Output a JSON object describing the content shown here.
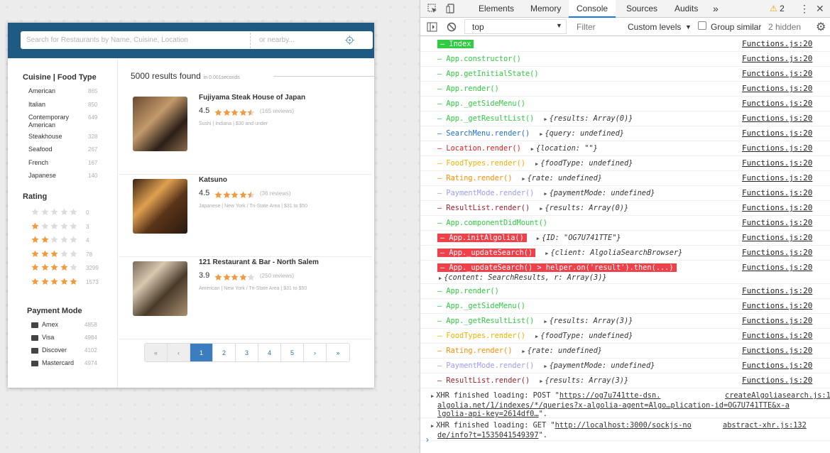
{
  "search": {
    "placeholder": "Search for Restaurants by Name, Cuisine, Location",
    "nearby_placeholder": "or nearby..."
  },
  "sidebar": {
    "cuisine_title": "Cuisine | Food Type",
    "cuisines": [
      {
        "name": "American",
        "count": "865"
      },
      {
        "name": "Italian",
        "count": "850"
      },
      {
        "name": "Contemporary American",
        "count": "649"
      },
      {
        "name": "Steakhouse",
        "count": "328"
      },
      {
        "name": "Seafood",
        "count": "267"
      },
      {
        "name": "French",
        "count": "167"
      },
      {
        "name": "Japanese",
        "count": "140"
      }
    ],
    "rating_title": "Rating",
    "ratings": [
      {
        "stars": 0,
        "count": "0"
      },
      {
        "stars": 1,
        "count": "3"
      },
      {
        "stars": 2,
        "count": "4"
      },
      {
        "stars": 3,
        "count": "78"
      },
      {
        "stars": 4,
        "count": "3299"
      },
      {
        "stars": 5,
        "count": "1573"
      }
    ],
    "payment_title": "Payment Mode",
    "payments": [
      {
        "name": "Amex",
        "count": "4858"
      },
      {
        "name": "Visa",
        "count": "4984"
      },
      {
        "name": "Discover",
        "count": "4102"
      },
      {
        "name": "Mastercard",
        "count": "4974"
      }
    ]
  },
  "results": {
    "count_text": "5000 results found",
    "time_text": "in 0.001seconds",
    "items": [
      {
        "name": "Fujiyama Steak House of Japan",
        "score": "4.5",
        "stars": 4.5,
        "reviews": "(165 reviews)",
        "meta": "Sushi | Indiana | $30 and under"
      },
      {
        "name": "Katsuno",
        "score": "4.5",
        "stars": 4.5,
        "reviews": "(36 reviews)",
        "meta": "Japanese | New York / Tri-State Area | $31 to $50"
      },
      {
        "name": "121 Restaurant & Bar - North Salem",
        "score": "3.9",
        "stars": 3.9,
        "reviews": "(250 reviews)",
        "meta": "American | New York / Tri-State Area | $31 to $50"
      }
    ]
  },
  "pager": [
    "«",
    "‹",
    "1",
    "2",
    "3",
    "4",
    "5",
    "›",
    "»"
  ],
  "devtools": {
    "tabs": [
      "Elements",
      "Memory",
      "Console",
      "Sources",
      "Audits"
    ],
    "active_tab": "Console",
    "warnings": "2",
    "context": "top",
    "filter_placeholder": "Filter",
    "levels": "Custom levels",
    "group_similar": "Group similar",
    "hidden": "2 hidden",
    "source": "Functions.js:20",
    "logs": [
      {
        "text": "– Index",
        "color": "#ffffff",
        "bg": "#2ecc40",
        "obj": ""
      },
      {
        "text": "– App.constructor()",
        "color": "#2ecc40",
        "bg": "",
        "obj": ""
      },
      {
        "text": "– App.getInitialState()",
        "color": "#2ecc40",
        "bg": "",
        "obj": ""
      },
      {
        "text": "– App.render()",
        "color": "#2ecc40",
        "bg": "",
        "obj": ""
      },
      {
        "text": "– App._getSideMenu()",
        "color": "#2ecc40",
        "bg": "",
        "obj": ""
      },
      {
        "text": "– App._getResultList()",
        "color": "#2ecc40",
        "bg": "",
        "obj": "{results: Array(0)}"
      },
      {
        "text": "– SearchMenu.render()",
        "color": "#1f6fd1",
        "bg": "",
        "obj": "{query: undefined}"
      },
      {
        "text": "– Location.render()",
        "color": "#e02020",
        "bg": "",
        "obj": "{location: \"\"}"
      },
      {
        "text": "– FoodTypes.render()",
        "color": "#f0b000",
        "bg": "",
        "obj": "{foodType: undefined}"
      },
      {
        "text": "– Rating.render()",
        "color": "#ff8c00",
        "bg": "",
        "obj": "{rate: undefined}"
      },
      {
        "text": "– PaymentMode.render()",
        "color": "#9c9cf0",
        "bg": "",
        "obj": "{paymentMode: undefined}"
      },
      {
        "text": "– ResultList.render()",
        "color": "#a02030",
        "bg": "",
        "obj": "{results: Array(0)}"
      },
      {
        "text": "– App.componentDidMount()",
        "color": "#2ecc40",
        "bg": "",
        "obj": ""
      },
      {
        "text": "– App.initAlgolia()",
        "color": "#ffffff",
        "bg": "#f0404a",
        "obj": "{ID: \"OG7U741TTE\"}"
      },
      {
        "text": "– App._updateSearch()",
        "color": "#ffffff",
        "bg": "#f0404a",
        "obj": "{client: AlgoliaSearchBrowser}"
      },
      {
        "text": "– App._updateSearch() > helper.on('result').then(...)",
        "color": "#ffffff",
        "bg": "#f0404a",
        "obj": ""
      },
      {
        "text": "– App.render()",
        "color": "#2ecc40",
        "bg": "",
        "obj": ""
      },
      {
        "text": "– App._getSideMenu()",
        "color": "#2ecc40",
        "bg": "",
        "obj": ""
      },
      {
        "text": "– App._getResultList()",
        "color": "#2ecc40",
        "bg": "",
        "obj": "{results: Array(3)}"
      },
      {
        "text": "– FoodTypes.render()",
        "color": "#f0b000",
        "bg": "",
        "obj": "{foodType: undefined}"
      },
      {
        "text": "– Rating.render()",
        "color": "#ff8c00",
        "bg": "",
        "obj": "{rate: undefined}"
      },
      {
        "text": "– PaymentMode.render()",
        "color": "#9c9cf0",
        "bg": "",
        "obj": "{paymentMode: undefined}"
      },
      {
        "text": "– ResultList.render()",
        "color": "#a02030",
        "bg": "",
        "obj": "{results: Array(3)}"
      }
    ],
    "update_result_obj": "{content: SearchResults, r: Array(3)}",
    "xhr": [
      {
        "pre": "XHR finished loading: POST \"",
        "url1": "https://og7u741tte-dsn.",
        "src": "createAlgoliasearch.js:121",
        "url2": "algolia.net/1/indexes/*/queries?x-algolia-agent=Algo…plication-id=OG7U741TTE&x-a",
        "url3": "lgolia-api-key=2614df0…",
        "post": "\"."
      },
      {
        "pre": "XHR finished loading: GET \"",
        "url1": "http://localhost:3000/sockjs-no",
        "src": "abstract-xhr.js:132",
        "url2": "de/info?t=1535041549397",
        "url3": "",
        "post": "\"."
      }
    ]
  }
}
